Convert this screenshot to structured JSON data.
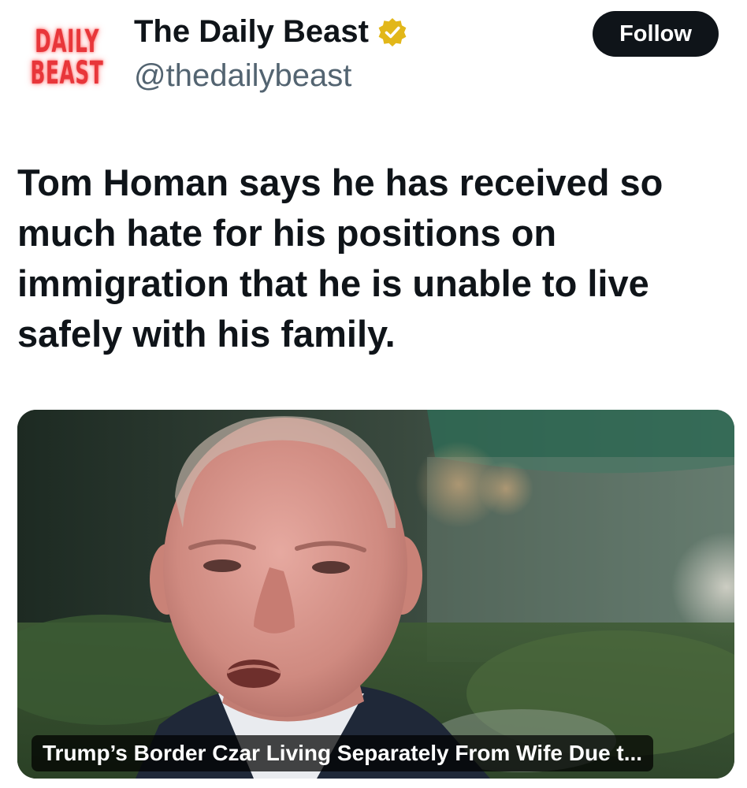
{
  "account": {
    "logo_line1": "DAILY",
    "logo_line2": "BEAST",
    "display_name": "The Daily Beast",
    "handle": "@thedailybeast",
    "verified_icon": "verified-badge-gold"
  },
  "follow_label": "Follow",
  "tweet": {
    "text": "Tom Homan says he has received so much hate for his positions on immigration that he is unable to live safely with his family."
  },
  "card": {
    "headline": "Trump’s Border Czar Living Separately From Wife Due t..."
  },
  "colors": {
    "logo_red": "#e8363a",
    "verified_gold": "#e2b719",
    "follow_bg": "#0f1419",
    "handle_gray": "#536471"
  }
}
